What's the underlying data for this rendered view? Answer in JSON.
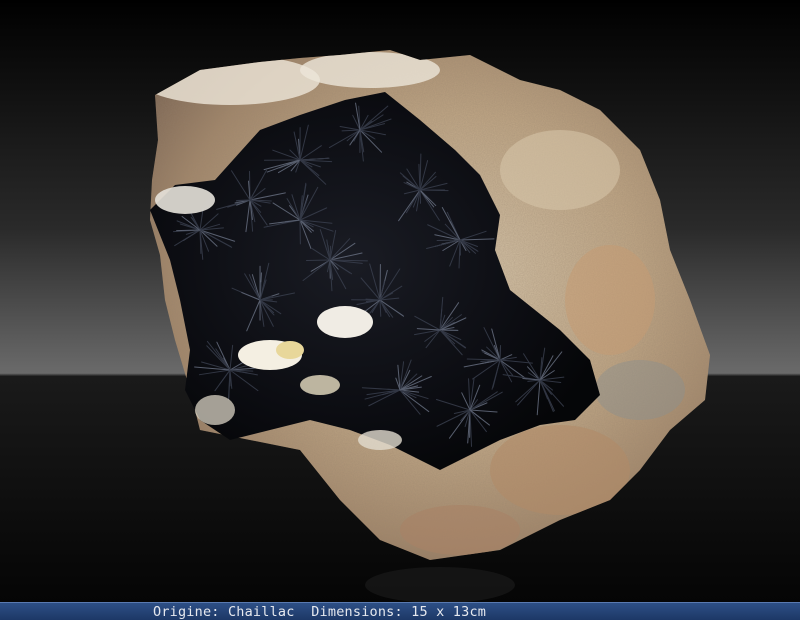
{
  "caption": {
    "text": "Origine: Chaillac  Dimensions: 15 x 13cm",
    "bar_color": "#234276",
    "text_color": "#e6e9ef"
  },
  "photo": {
    "subject": "mineral-specimen",
    "background_top": "#000000",
    "background_band": "#5c5c5c",
    "matrix_color": "#c9b89a",
    "crystal_color": "#101218"
  }
}
